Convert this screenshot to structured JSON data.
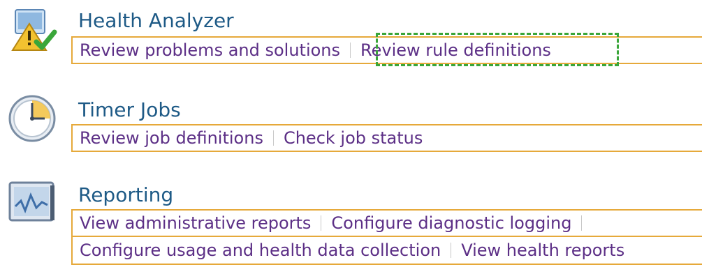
{
  "sections": [
    {
      "title": "Health Analyzer",
      "icon": "health-analyzer-icon",
      "links": [
        "Review problems and solutions",
        "Review rule definitions"
      ]
    },
    {
      "title": "Timer Jobs",
      "icon": "clock-icon",
      "links": [
        "Review job definitions",
        "Check job status"
      ]
    },
    {
      "title": "Reporting",
      "icon": "monitor-chart-icon",
      "links_row1": [
        "View administrative reports",
        "Configure diagnostic logging"
      ],
      "links_row2": [
        "Configure usage and health data collection",
        "View health reports"
      ]
    }
  ],
  "highlight": {
    "target": "Review rule definitions",
    "color": "#3aa63a"
  },
  "colors": {
    "title": "#1e5a86",
    "link": "#5c2f86",
    "border": "#e6a93a"
  }
}
